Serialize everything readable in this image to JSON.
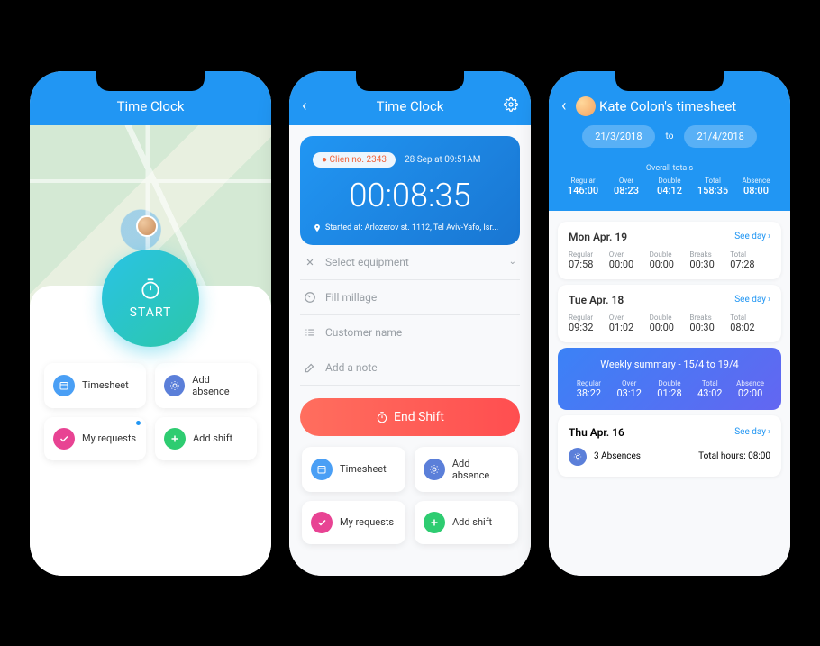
{
  "phone1": {
    "title": "Time Clock",
    "start_label": "START",
    "actions": [
      {
        "label": "Timesheet"
      },
      {
        "label": "Add absence"
      },
      {
        "label": "My requests"
      },
      {
        "label": "Add shift"
      }
    ]
  },
  "phone2": {
    "title": "Time Clock",
    "client_pill": "Clien no. 2343",
    "timestamp": "28 Sep at 09:51AM",
    "elapsed": "00:08:35",
    "location": "Started at: Arlozerov st. 1112, Tel Aviv-Yafo, Isr...",
    "form": {
      "equipment": "Select equipment",
      "mileage": "Fill millage",
      "customer": "Customer name",
      "note": "Add a note"
    },
    "end_shift": "End Shift",
    "actions": [
      {
        "label": "Timesheet"
      },
      {
        "label": "Add absence"
      },
      {
        "label": "My requests"
      },
      {
        "label": "Add shift"
      }
    ]
  },
  "phone3": {
    "title": "Kate Colon's timesheet",
    "range": {
      "from": "21/3/2018",
      "to_label": "to",
      "to": "21/4/2018"
    },
    "totals_title": "Overall totals",
    "totals": {
      "regular_label": "Regular",
      "regular": "146:00",
      "over_label": "Over",
      "over": "08:23",
      "double_label": "Double",
      "double": "04:12",
      "total_label": "Total",
      "total": "158:35",
      "absence_label": "Absence",
      "absence": "08:00"
    },
    "days": [
      {
        "date": "Mon Apr. 19",
        "see": "See day",
        "cols": [
          "Regular",
          "Over",
          "Double",
          "Breaks",
          "Total"
        ],
        "vals": [
          "07:58",
          "00:00",
          "00:00",
          "00:30",
          "07:28"
        ]
      },
      {
        "date": "Tue Apr. 18",
        "see": "See day",
        "cols": [
          "Regular",
          "Over",
          "Double",
          "Breaks",
          "Total"
        ],
        "vals": [
          "09:32",
          "01:02",
          "00:00",
          "00:30",
          "08:02"
        ]
      }
    ],
    "weekly": {
      "title": "Weekly summary - 15/4 to 19/4",
      "cols": [
        "Regular",
        "Over",
        "Double",
        "Total",
        "Absence"
      ],
      "vals": [
        "38:22",
        "03:12",
        "01:28",
        "43:02",
        "02:00"
      ]
    },
    "thu": {
      "date": "Thu Apr. 16",
      "see": "See day",
      "absences": "3 Absences",
      "total_hours": "Total hours: 08:00"
    }
  }
}
